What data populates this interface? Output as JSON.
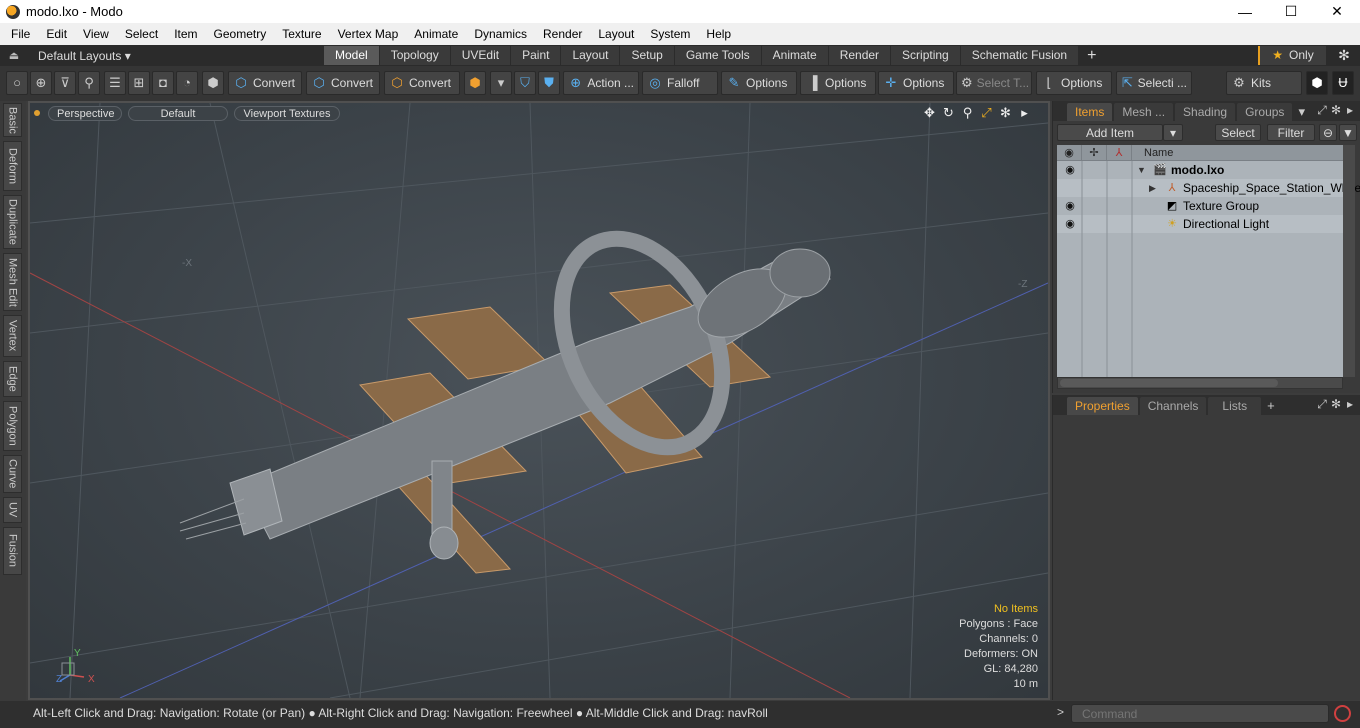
{
  "window": {
    "title": "modo.lxo - Modo",
    "controls": {
      "minimize": "—",
      "maximize": "☐",
      "close": "✕"
    }
  },
  "menubar": {
    "items": [
      "File",
      "Edit",
      "View",
      "Select",
      "Item",
      "Geometry",
      "Texture",
      "Vertex Map",
      "Animate",
      "Dynamics",
      "Render",
      "Layout",
      "System",
      "Help"
    ]
  },
  "layoutbar": {
    "layouts_label": "Default Layouts ▾",
    "tabs": [
      "Model",
      "Topology",
      "UVEdit",
      "Paint",
      "Layout",
      "Setup",
      "Game Tools",
      "Animate",
      "Render",
      "Scripting",
      "Schematic Fusion"
    ],
    "active_tab": "Model",
    "add_tab": "+",
    "only_label": "Only"
  },
  "toolbar": {
    "convert1": "Convert",
    "convert2": "Convert",
    "convert3": "Convert",
    "action": "Action  ...",
    "falloff": "Falloff",
    "options1": "Options",
    "options2": "Options",
    "options3": "Options",
    "select_t": "Select T...",
    "options4": "Options",
    "selecti": "Selecti ...",
    "kits": "Kits"
  },
  "sidetabs": [
    "Basic",
    "Deform",
    "Duplicate",
    "Mesh Edit",
    "Vertex",
    "Edge",
    "Polygon",
    "Curve",
    "UV",
    "Fusion"
  ],
  "viewport": {
    "view_mode": "Perspective",
    "shading": "Default",
    "textures": "Viewport Textures",
    "axis_x_neg": "-X",
    "axis_z_neg": "-Z",
    "info": {
      "selection": "No Items",
      "polygons": "Polygons : Face",
      "channels": "Channels: 0",
      "deformers": "Deformers: ON",
      "gl": "GL: 84,280",
      "scale": "10 m"
    },
    "gizmo": {
      "x": "X",
      "y": "Y",
      "z": "Z"
    }
  },
  "items_panel": {
    "tabs": [
      "Items",
      "Mesh ...",
      "Shading",
      "Groups"
    ],
    "active_tab": "Items",
    "add_item": "Add Item",
    "select": "Select",
    "filter": "Filter",
    "column_name": "Name",
    "tree": [
      {
        "label": "modo.lxo",
        "bold": true
      },
      {
        "label": "Spaceship_Space_Station_White",
        "bold": false
      },
      {
        "label": "Texture Group",
        "bold": false
      },
      {
        "label": "Directional Light",
        "bold": false
      }
    ]
  },
  "props_panel": {
    "tabs": [
      "Properties",
      "Channels",
      "Lists"
    ],
    "active_tab": "Properties",
    "add": "+"
  },
  "statusbar": {
    "hint": "Alt-Left Click and Drag: Navigation: Rotate (or Pan) ● Alt-Right Click and Drag: Navigation: Freewheel ● Alt-Middle Click and Drag: navRoll",
    "prompt": ">",
    "command_placeholder": "Command"
  },
  "colors": {
    "accent": "#f0a030",
    "panel_bg": "#3a3a3a",
    "viewport_bg": "#3e454b",
    "tree_bg": "#acb3b9"
  }
}
